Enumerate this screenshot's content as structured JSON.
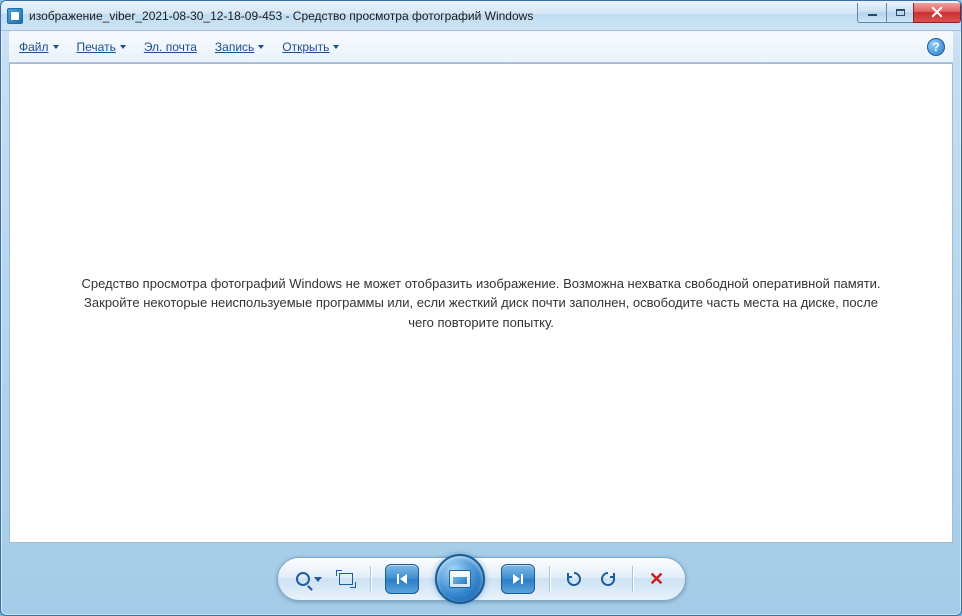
{
  "window": {
    "title": "изображение_viber_2021-08-30_12-18-09-453 - Средство просмотра фотографий Windows"
  },
  "menu": {
    "file": "Файл",
    "print": "Печать",
    "email": "Эл. почта",
    "burn": "Запись",
    "open": "Открыть"
  },
  "content": {
    "error": "Средство просмотра фотографий Windows не может отобразить изображение. Возможна нехватка свободной оперативной памяти. Закройте некоторые неиспользуемые программы или, если жесткий диск почти заполнен, освободите часть места на диске, после чего повторите попытку."
  },
  "help_glyph": "?"
}
